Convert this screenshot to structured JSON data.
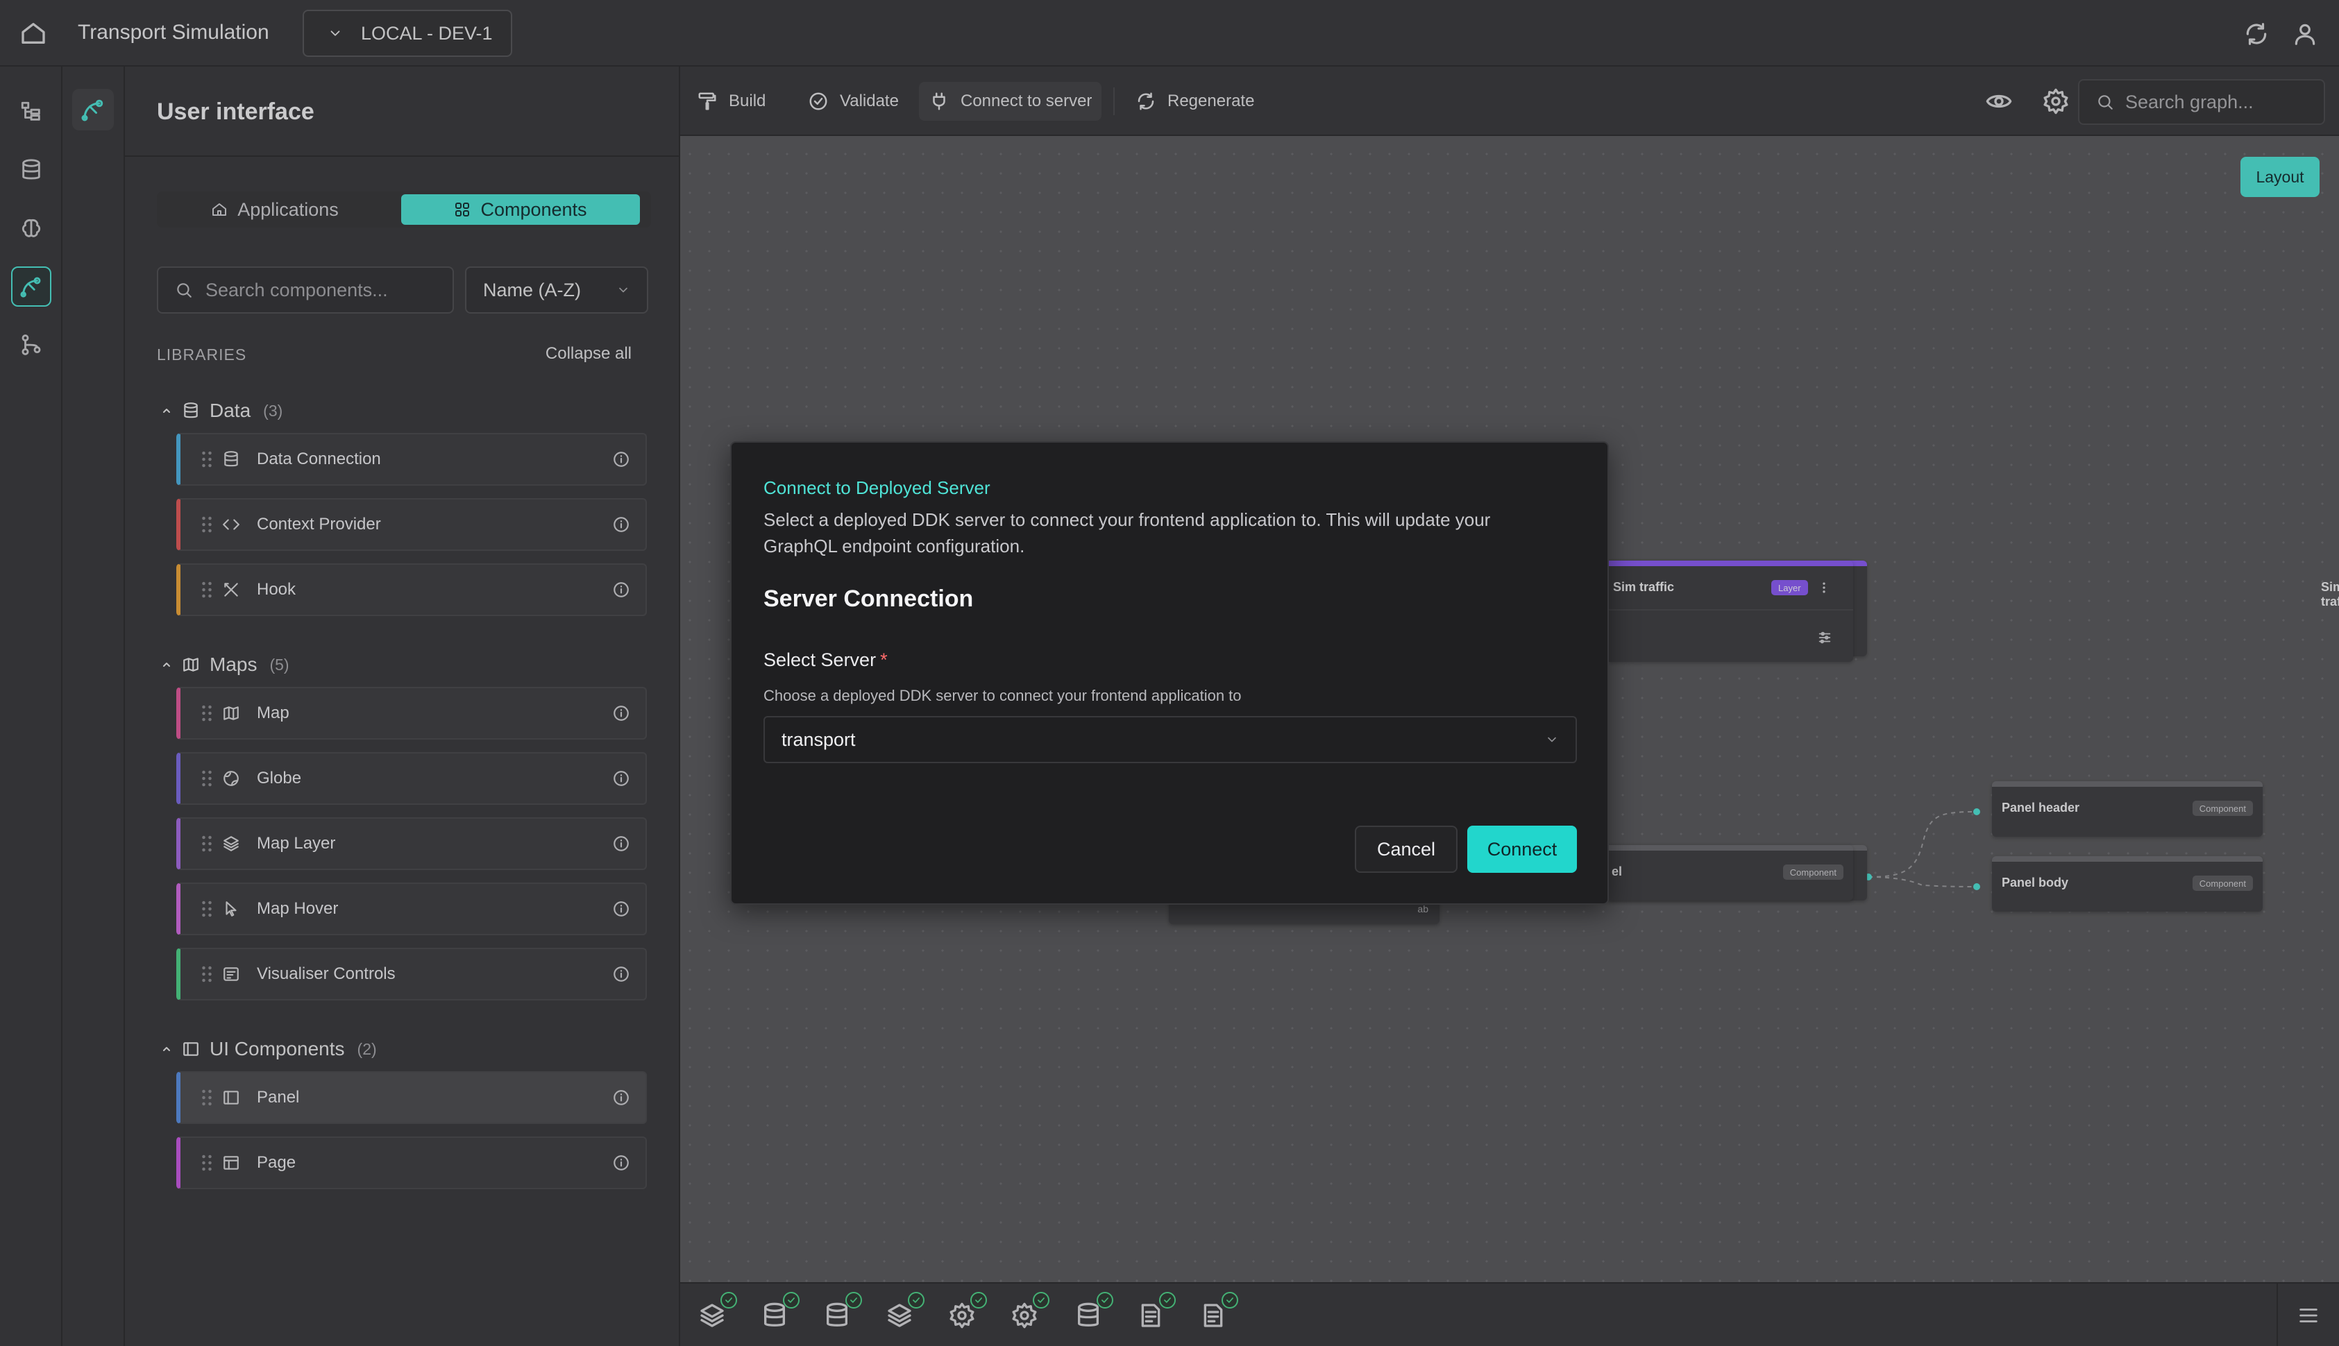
{
  "header": {
    "app_title": "Transport Simulation",
    "environment": "LOCAL - DEV-1"
  },
  "panel": {
    "title": "User interface",
    "tabs": [
      {
        "label": "Applications",
        "active": false
      },
      {
        "label": "Components",
        "active": true
      }
    ],
    "search_placeholder": "Search components...",
    "sort": "Name (A-Z)",
    "libraries_label": "LIBRARIES",
    "collapse_all": "Collapse all",
    "groups": [
      {
        "label": "Data",
        "count": "(3)",
        "items": [
          {
            "label": "Data Connection",
            "icon": "database-icon",
            "color": "#4fb3e3"
          },
          {
            "label": "Context Provider",
            "icon": "code-icon",
            "color": "#e35a5a"
          },
          {
            "label": "Hook",
            "icon": "tools-icon",
            "color": "#f0a73a"
          }
        ]
      },
      {
        "label": "Maps",
        "count": "(5)",
        "items": [
          {
            "label": "Map",
            "icon": "map-icon",
            "color": "#e35a9e"
          },
          {
            "label": "Globe",
            "icon": "globe-icon",
            "color": "#7d6ce3"
          },
          {
            "label": "Map Layer",
            "icon": "layers-icon",
            "color": "#a66ce3"
          },
          {
            "label": "Map Hover",
            "icon": "cursor-icon",
            "color": "#d46ce3"
          },
          {
            "label": "Visualiser Controls",
            "icon": "controls-icon",
            "color": "#4fd48a"
          }
        ]
      },
      {
        "label": "UI Components",
        "count": "(2)",
        "items": [
          {
            "label": "Panel",
            "icon": "panel-icon",
            "color": "#5a8fe3",
            "selected": true
          },
          {
            "label": "Page",
            "icon": "page-icon",
            "color": "#c95ae3"
          }
        ]
      }
    ]
  },
  "toolbar": {
    "build": "Build",
    "validate": "Validate",
    "connect": "Connect to server",
    "regenerate": "Regenerate",
    "search_placeholder": "Search graph...",
    "layout": "Layout"
  },
  "nodes": {
    "sim_traffic": {
      "title": "Sim traffic",
      "badge": "Layer",
      "color": "#8b5cf6"
    },
    "panel": {
      "title": "el",
      "badge": "Component",
      "color": "#6a6a6e"
    },
    "panel_header": {
      "title": "Panel header",
      "badge": "Component",
      "color": "#6a6a6e"
    },
    "panel_body": {
      "title": "Panel body",
      "badge": "Component",
      "color": "#6a6a6e"
    },
    "hidden_node_text": "ab"
  },
  "modal": {
    "title": "Connect to Deployed Server",
    "description": "Select a deployed DDK server to connect your frontend application to. This will update your GraphQL endpoint configuration.",
    "section": "Server Connection",
    "field_label": "Select Server",
    "required_mark": "*",
    "field_help": "Choose a deployed DDK server to connect your frontend application to",
    "selected_server": "transport",
    "cancel": "Cancel",
    "connect": "Connect"
  },
  "bottom_icons": [
    "layers-icon",
    "database-icon",
    "database-icon",
    "layers-icon",
    "gear-icon",
    "gear-icon",
    "database-icon",
    "document-icon",
    "document-icon"
  ],
  "colors": {
    "accent": "#4fe3d6",
    "layer": "#8b5cf6",
    "success": "#4fd48a"
  }
}
